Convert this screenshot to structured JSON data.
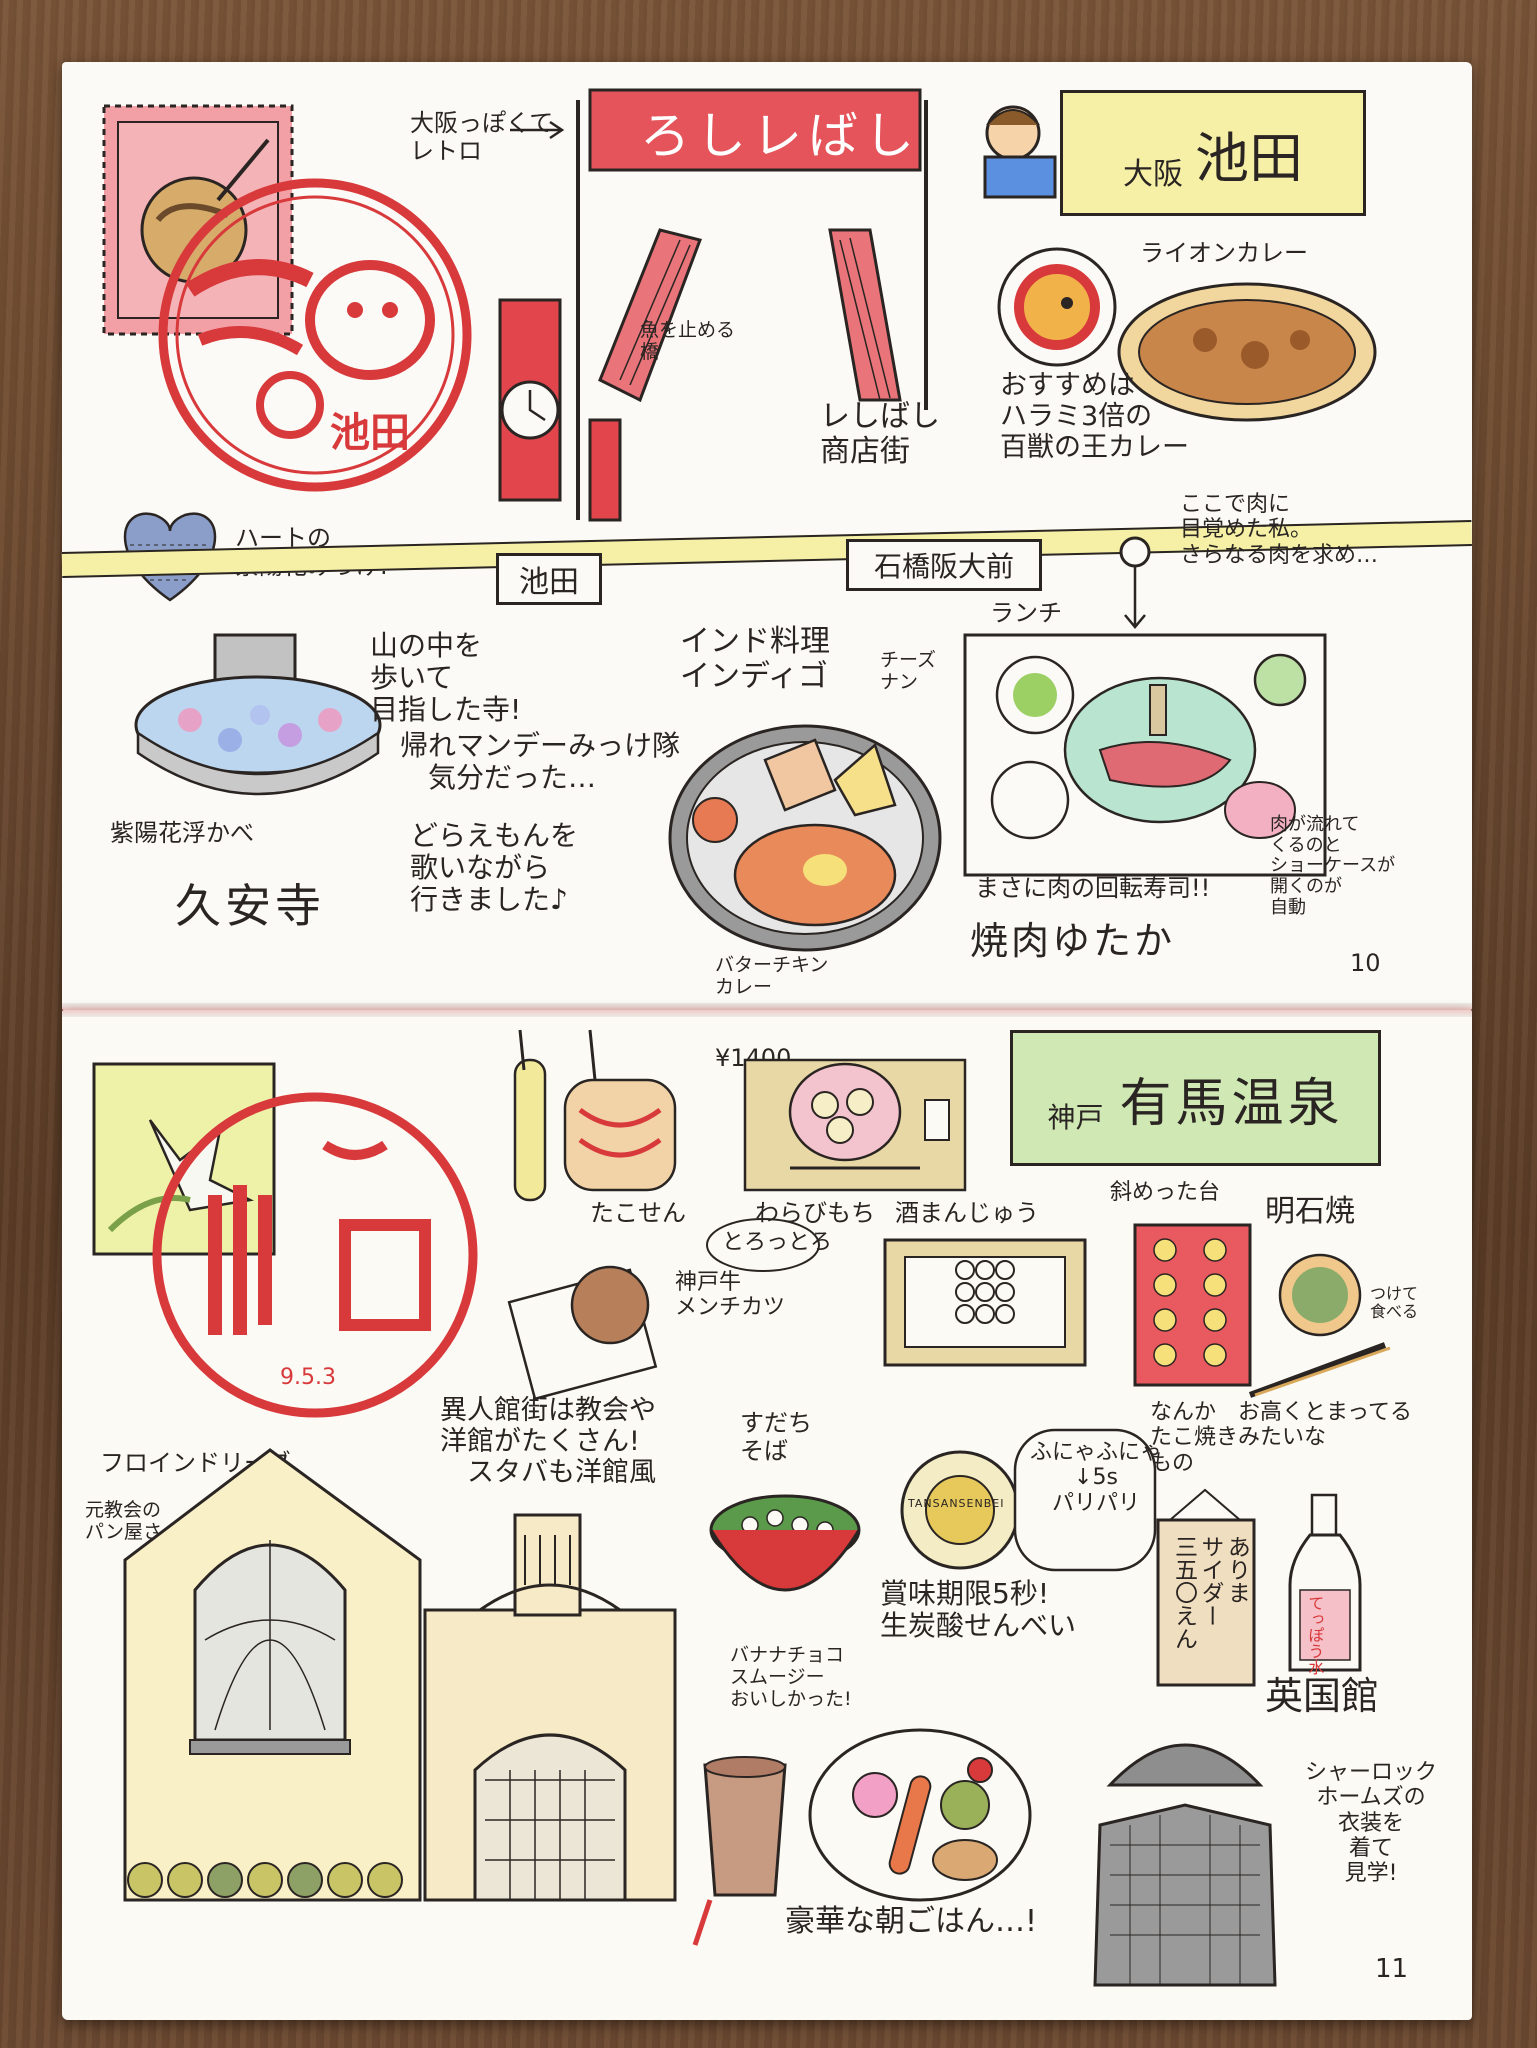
{
  "page10": {
    "page_number": "10",
    "shoutout": "大阪っぽくて\nレトロ",
    "gate_sign": "ろしレばし",
    "bridge_note": "魚を止める\n橋",
    "shopping_street": "レしばし\n商店街",
    "area_title_prefix": "大阪",
    "area_title": "池田",
    "lion_curry_label": "ライオンカレー",
    "curry_recommend": "おすすめは\nハラミ3倍の\n百獣の王カレー",
    "meat_awakening": "ここで肉に\n目覚めた私。\nさらなる肉を求め…",
    "hydrangea_heart": "ハートの\n紫陽花みっけ!",
    "station_ikeda": "池田",
    "station_ishibashi": "石橋阪大前",
    "lunch_label": "ランチ",
    "temple_walk": "山の中を\n歩いて\n目指した寺!",
    "mandee_note": "帰れマンデーみっけ隊\n　気分だった…",
    "doraemon_note": "どらえもんを\n歌いながら\n行きました♪",
    "floating_hydrangea": "紫陽花浮かべ",
    "temple_name": "久安寺",
    "indian_restaurant": "インド料理\nインディゴ",
    "cheese_naan": "チーズ\nナン",
    "butter_chicken": "バターチキン\nカレー",
    "conveyor_meat": "まさに肉の回転寿司!!",
    "yakiniku_name": "焼肉ゆたか",
    "showcase_note": "肉が流れて\nくるのと\nショーケースが\n開くのが\n自動",
    "stamp_text": "池田"
  },
  "page11": {
    "page_number": "11",
    "area_title_prefix": "神戸",
    "area_title": "有馬温泉",
    "price": "¥1400",
    "takosen": "たこせん",
    "torotto": "とろっとろ",
    "warabimochi": "わらびもち",
    "sake_manju": "酒まんじゅう",
    "tilted_stand": "斜めった台",
    "akashiyaki": "明石焼",
    "dip_note": "つけて\n食べる",
    "kobe_menchi": "神戸牛\nメンチカツ",
    "akashiyaki_note": "なんか　お高くとまってる\nたこ焼きみたいな\nもの",
    "ijinkan_note": "異人館街は教会や\n洋館がたくさん!\n　スタバも洋館風",
    "freundlieb": "フロインドリーブ",
    "former_church": "元教会の\nパン屋さん!",
    "sudachi_soba": "すだち\nそば",
    "crispy_note": "ふにゃふにゃ\n↓5s\nパリパリ",
    "senbei_note": "賞味期限5秒!\n生炭酸せんべい",
    "banana_smoothie": "バナナチョコ\nスムージー\nおいしかった!",
    "breakfast": "豪華な朝ごはん…!",
    "arima_cider": "ありま\nサイダー\n三五〇えん",
    "bottle_label": "てっぽう水",
    "british_house": "英国館",
    "sherlock_note": "シャーロック\nホームズの\n衣装を\n着て\n見学!",
    "tandan_seal": "TANSANSENBEI",
    "stamp_date": "9.5.3"
  },
  "colors": {
    "stamp_red": "#d8393b",
    "pencil_pink": "#f08a8f",
    "sign_green": "#cfe8b4",
    "sign_yellow": "#f5f0a6",
    "pencil_yellow": "#f1e08a",
    "tan": "#e8d8a6"
  }
}
